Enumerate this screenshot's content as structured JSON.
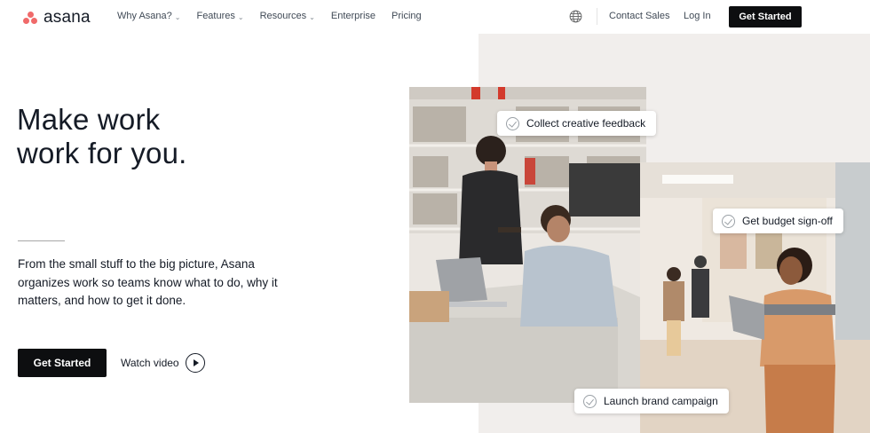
{
  "brand": {
    "name": "asana",
    "logo_color": "#f06a6a"
  },
  "nav": {
    "links": [
      {
        "label": "Why Asana?",
        "has_dropdown": true
      },
      {
        "label": "Features",
        "has_dropdown": true
      },
      {
        "label": "Resources",
        "has_dropdown": true
      },
      {
        "label": "Enterprise",
        "has_dropdown": false
      },
      {
        "label": "Pricing",
        "has_dropdown": false
      }
    ],
    "globe_icon": "globe-icon",
    "contact_label": "Contact Sales",
    "login_label": "Log In",
    "cta_label": "Get Started"
  },
  "hero": {
    "headline_line1": "Make work",
    "headline_line2": "work for you.",
    "subtext": "From the small stuff to the big picture, Asana organizes work so teams know what to do, why it matters, and how to get it done.",
    "cta_label": "Get Started",
    "watch_label": "Watch video"
  },
  "task_pills": [
    {
      "label": "Collect creative feedback",
      "icon": "check-circle-icon"
    },
    {
      "label": "Get budget sign-off",
      "icon": "check-circle-icon"
    },
    {
      "label": "Launch brand campaign",
      "icon": "check-circle-icon"
    }
  ],
  "colors": {
    "primary_button": "#0d0e10",
    "panel_bg": "#f1eeec"
  }
}
